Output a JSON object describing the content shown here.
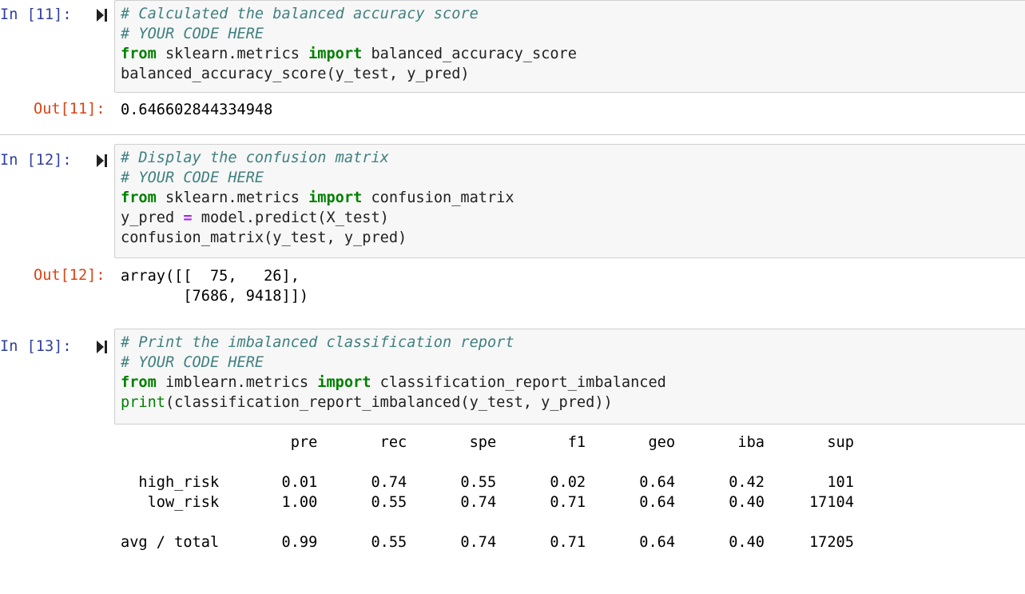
{
  "cells": [
    {
      "in_prompt": "In [11]:",
      "code": [
        {
          "parts": [
            {
              "t": "cm",
              "v": "# Calculated the balanced accuracy score"
            }
          ]
        },
        {
          "parts": [
            {
              "t": "cm",
              "v": "# YOUR CODE HERE"
            }
          ]
        },
        {
          "parts": [
            {
              "t": "kw",
              "v": "from"
            },
            {
              "t": "tx",
              "v": " sklearn.metrics "
            },
            {
              "t": "kw",
              "v": "import"
            },
            {
              "t": "tx",
              "v": " balanced_accuracy_score"
            }
          ]
        },
        {
          "parts": [
            {
              "t": "tx",
              "v": "balanced_accuracy_score(y_test, y_pred)"
            }
          ]
        }
      ],
      "out_prompt": "Out[11]:",
      "output": [
        "0.646602844334948"
      ]
    },
    {
      "in_prompt": "In [12]:",
      "code": [
        {
          "parts": [
            {
              "t": "cm",
              "v": "# Display the confusion matrix"
            }
          ]
        },
        {
          "parts": [
            {
              "t": "cm",
              "v": "# YOUR CODE HERE"
            }
          ]
        },
        {
          "parts": [
            {
              "t": "kw",
              "v": "from"
            },
            {
              "t": "tx",
              "v": " sklearn.metrics "
            },
            {
              "t": "kw",
              "v": "import"
            },
            {
              "t": "tx",
              "v": " confusion_matrix"
            }
          ]
        },
        {
          "parts": [
            {
              "t": "tx",
              "v": "y_pred "
            },
            {
              "t": "op",
              "v": "="
            },
            {
              "t": "tx",
              "v": " model.predict(X_test)"
            }
          ]
        },
        {
          "parts": [
            {
              "t": "tx",
              "v": "confusion_matrix(y_test, y_pred)"
            }
          ]
        }
      ],
      "out_prompt": "Out[12]:",
      "output": [
        "array([[  75,   26],",
        "       [7686, 9418]])"
      ]
    },
    {
      "in_prompt": "In [13]:",
      "code": [
        {
          "parts": [
            {
              "t": "cm",
              "v": "# Print the imbalanced classification report"
            }
          ]
        },
        {
          "parts": [
            {
              "t": "cm",
              "v": "# YOUR CODE HERE"
            }
          ]
        },
        {
          "parts": [
            {
              "t": "kw",
              "v": "from"
            },
            {
              "t": "tx",
              "v": " imblearn.metrics "
            },
            {
              "t": "kw",
              "v": "import"
            },
            {
              "t": "tx",
              "v": " classification_report_imbalanced"
            }
          ]
        },
        {
          "parts": [
            {
              "t": "bi",
              "v": "print"
            },
            {
              "t": "tx",
              "v": "(classification_report_imbalanced(y_test, y_pred))"
            }
          ]
        }
      ],
      "output": [
        "                   pre       rec       spe        f1       geo       iba       sup",
        "",
        "  high_risk       0.01      0.74      0.55      0.02      0.64      0.42       101",
        "   low_risk       1.00      0.55      0.74      0.71      0.64      0.40     17104",
        "",
        "avg / total       0.99      0.55      0.74      0.71      0.64      0.40     17205"
      ]
    }
  ]
}
